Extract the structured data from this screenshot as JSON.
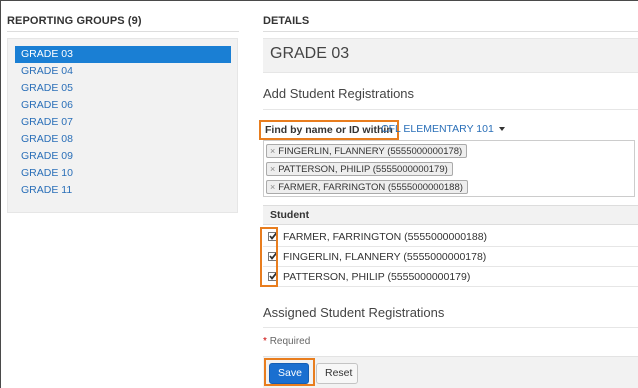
{
  "reporting_groups": {
    "title": "REPORTING GROUPS (9)",
    "items": [
      {
        "label": "GRADE 03",
        "active": true
      },
      {
        "label": "GRADE 04"
      },
      {
        "label": "GRADE 05"
      },
      {
        "label": "GRADE 06"
      },
      {
        "label": "GRADE 07"
      },
      {
        "label": "GRADE 08"
      },
      {
        "label": "GRADE 09"
      },
      {
        "label": "GRADE 10"
      },
      {
        "label": "GRADE 11"
      }
    ]
  },
  "details": {
    "title": "DETAILS",
    "grade": "GRADE 03",
    "add_heading": "Add Student Registrations",
    "find_label": "Find by name or ID within",
    "school": "CFL ELEMENTARY 101",
    "selected_tags": [
      "FINGERLIN, FLANNERY (5555000000178)",
      "PATTERSON, PHILIP (5555000000179)",
      "FARMER, FARRINGTON (5555000000188)"
    ],
    "table_header": "Student",
    "students": [
      {
        "name": "FARMER, FARRINGTON (5555000000188)",
        "checked": true
      },
      {
        "name": "FINGERLIN, FLANNERY (5555000000178)",
        "checked": true
      },
      {
        "name": "PATTERSON, PHILIP (5555000000179)",
        "checked": true
      }
    ],
    "assigned_heading": "Assigned Student Registrations",
    "required_star": "*",
    "required_text": "Required"
  },
  "buttons": {
    "save": "Save",
    "reset": "Reset"
  },
  "colors": {
    "accent": "#1a7fd4",
    "link": "#2a6fb8",
    "highlight": "#e87d1e"
  },
  "icons": {
    "remove_tag": "×",
    "dropdown": "caret-down-icon",
    "checkbox": "checkmark-icon"
  }
}
